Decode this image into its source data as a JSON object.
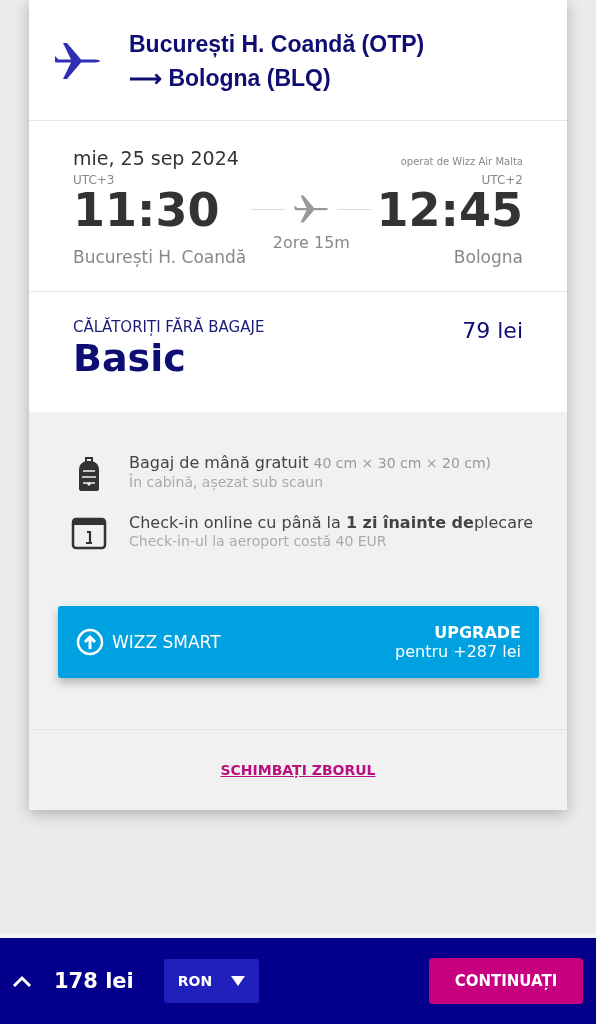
{
  "route": {
    "origin": "București H. Coandă (OTP)",
    "arrow": "⟶",
    "destination": "Bologna (BLQ)"
  },
  "flight": {
    "date": "mie, 25 sep 2024",
    "operator": "operat de Wizz Air Malta",
    "departure": {
      "timezone": "UTC+3",
      "time": "11:30",
      "city": "București H. Coandă"
    },
    "duration": "2ore 15m",
    "arrival": {
      "timezone": "UTC+2",
      "time": "12:45",
      "city": "Bologna"
    }
  },
  "fare": {
    "tagline": "CĂLĂTORIȚI FĂRĂ BAGAJE",
    "name": "Basic",
    "price": "79 lei"
  },
  "features": [
    {
      "kind": "backpack",
      "title": "Bagaj de mână gratuit",
      "detail": "40 cm × 30 cm × 20 cm)",
      "note": "În cabină, așezat sub scaun"
    },
    {
      "kind": "calendar",
      "title": "Check-in online cu până la **1 zi înainte de**plecare",
      "note": "Check-in-ul la aeroport costă 40 EUR"
    }
  ],
  "upgrade": {
    "label": "WIZZ SMART",
    "action": "UPGRADE",
    "price": "pentru +287 lei"
  },
  "change_link": "SCHIMBAȚI ZBORUL",
  "bottom_bar": {
    "total": "178 lei",
    "currency": "RON",
    "continue": "CONTINUAȚI"
  }
}
